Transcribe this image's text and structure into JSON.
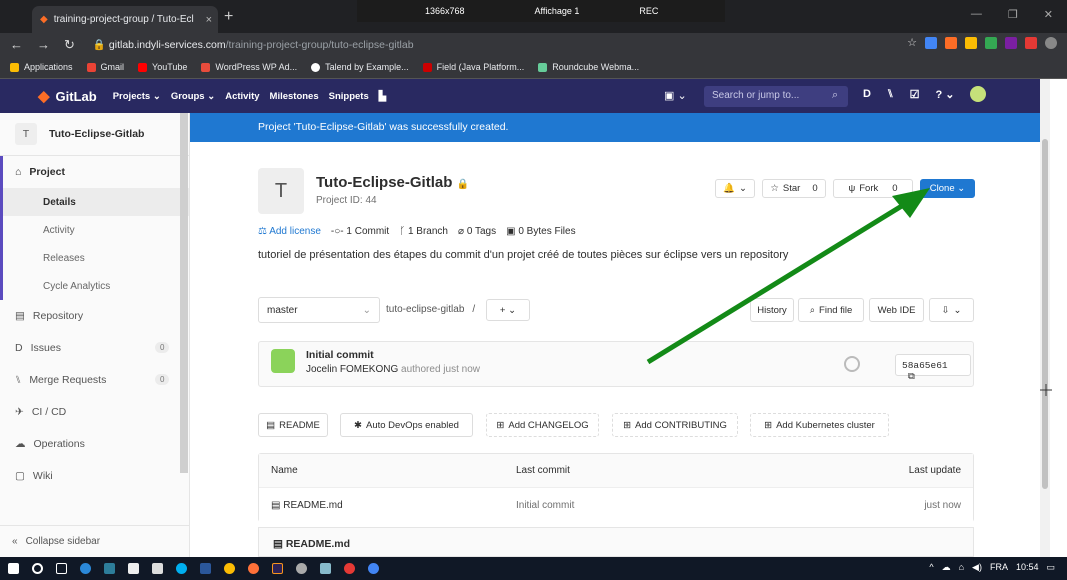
{
  "browser": {
    "tab_title": "training-project-group / Tuto-Ecl",
    "tab_close": "×",
    "new_tab": "+",
    "url_host": "gitlab.indyli-services.com",
    "url_path": "/training-project-group/tuto-eclipse-gitlab"
  },
  "recorder": {
    "resolution": "1366x768",
    "display": "Affichage 1",
    "rec": "REC"
  },
  "bookmarks": [
    "Applications",
    "Gmail",
    "YouTube",
    "WordPress WP Ad...",
    "Talend by Example...",
    "Field (Java Platform...",
    "Roundcube Webma..."
  ],
  "gitlab_nav": {
    "brand": "GitLab",
    "links": [
      "Projects ⌄",
      "Groups ⌄",
      "Activity",
      "Milestones",
      "Snippets"
    ],
    "search_placeholder": "Search or jump to..."
  },
  "sidebar": {
    "project_initial": "T",
    "project_name": "Tuto-Eclipse-Gitlab",
    "project_label": "Project",
    "sub_items": [
      "Details",
      "Activity",
      "Releases",
      "Cycle Analytics"
    ],
    "repository": "Repository",
    "issues": "Issues",
    "issues_count": "0",
    "merge_requests": "Merge Requests",
    "mr_count": "0",
    "cicd": "CI / CD",
    "operations": "Operations",
    "wiki": "Wiki",
    "collapse": "Collapse sidebar"
  },
  "flash": "Project 'Tuto-Eclipse-Gitlab' was successfully created.",
  "project": {
    "initial": "T",
    "title": "Tuto-Eclipse-Gitlab",
    "id": "Project ID: 44",
    "star": "Star",
    "star_count": "0",
    "fork": "Fork",
    "fork_count": "0",
    "clone": "Clone ⌄",
    "add_license": "Add license",
    "commits": "1 Commit",
    "branches": "1 Branch",
    "tags": "0 Tags",
    "files": "0 Bytes Files",
    "description": "tutoriel de présentation des étapes du commit d'un projet créé de toutes pièces sur éclipse vers un repository"
  },
  "repo": {
    "branch": "master",
    "path": "tuto-eclipse-gitlab",
    "history": "History",
    "find_file": "Find file",
    "web_ide": "Web IDE"
  },
  "commit": {
    "title": "Initial commit",
    "author": "Jocelin FOMEKONG",
    "time": "authored just now",
    "sha": "58a65e61"
  },
  "actions": [
    "README",
    "Auto DevOps enabled",
    "Add CHANGELOG",
    "Add CONTRIBUTING",
    "Add Kubernetes cluster"
  ],
  "files": {
    "headers": [
      "Name",
      "Last commit",
      "Last update"
    ],
    "rows": [
      {
        "name": "README.md",
        "commit": "Initial commit",
        "updated": "just now"
      }
    ]
  },
  "readme_title": "README.md",
  "tray": {
    "lang": "FRA",
    "time": "10:54"
  }
}
